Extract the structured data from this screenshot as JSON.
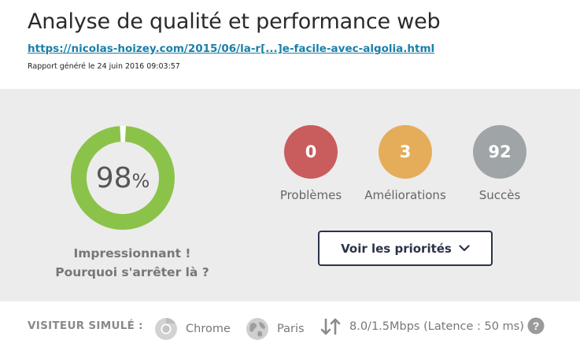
{
  "header": {
    "title": "Analyse de qualité et performance web",
    "url": "https://nicolas-hoizey.com/2015/06/la-r[...]e-facile-avec-algolia.html",
    "generated": "Rapport généré le 24 juin 2016 09:03:57"
  },
  "score": {
    "value": "98",
    "unit": "%",
    "fraction": 0.98,
    "verdict_line1": "Impressionnant !",
    "verdict_line2": "Pourquoi s'arrêter là ?"
  },
  "stats": [
    {
      "count": "0",
      "label": "Problèmes",
      "color": "#c95c5c"
    },
    {
      "count": "3",
      "label": "Améliorations",
      "color": "#e5ad5a"
    },
    {
      "count": "92",
      "label": "Succès",
      "color": "#9fa5a7"
    }
  ],
  "priorities_button": {
    "label": "Voir les priorités",
    "icon": "chevron-down-icon"
  },
  "footer": {
    "visitor_label": "VISITEUR SIMULÉ :",
    "browser": {
      "label": "Chrome",
      "icon": "chrome-icon"
    },
    "location": {
      "label": "Paris",
      "icon": "globe-icon"
    },
    "connection": {
      "label": "8.0/1.5Mbps (Latence : 50 ms)",
      "icon": "up-down-arrows-icon"
    },
    "help_icon": "help-icon"
  },
  "colors": {
    "gauge": "#8bc34a",
    "gauge_track": "#ffffff",
    "accent_link": "#1b7fa8",
    "button_border": "#2a3347"
  }
}
